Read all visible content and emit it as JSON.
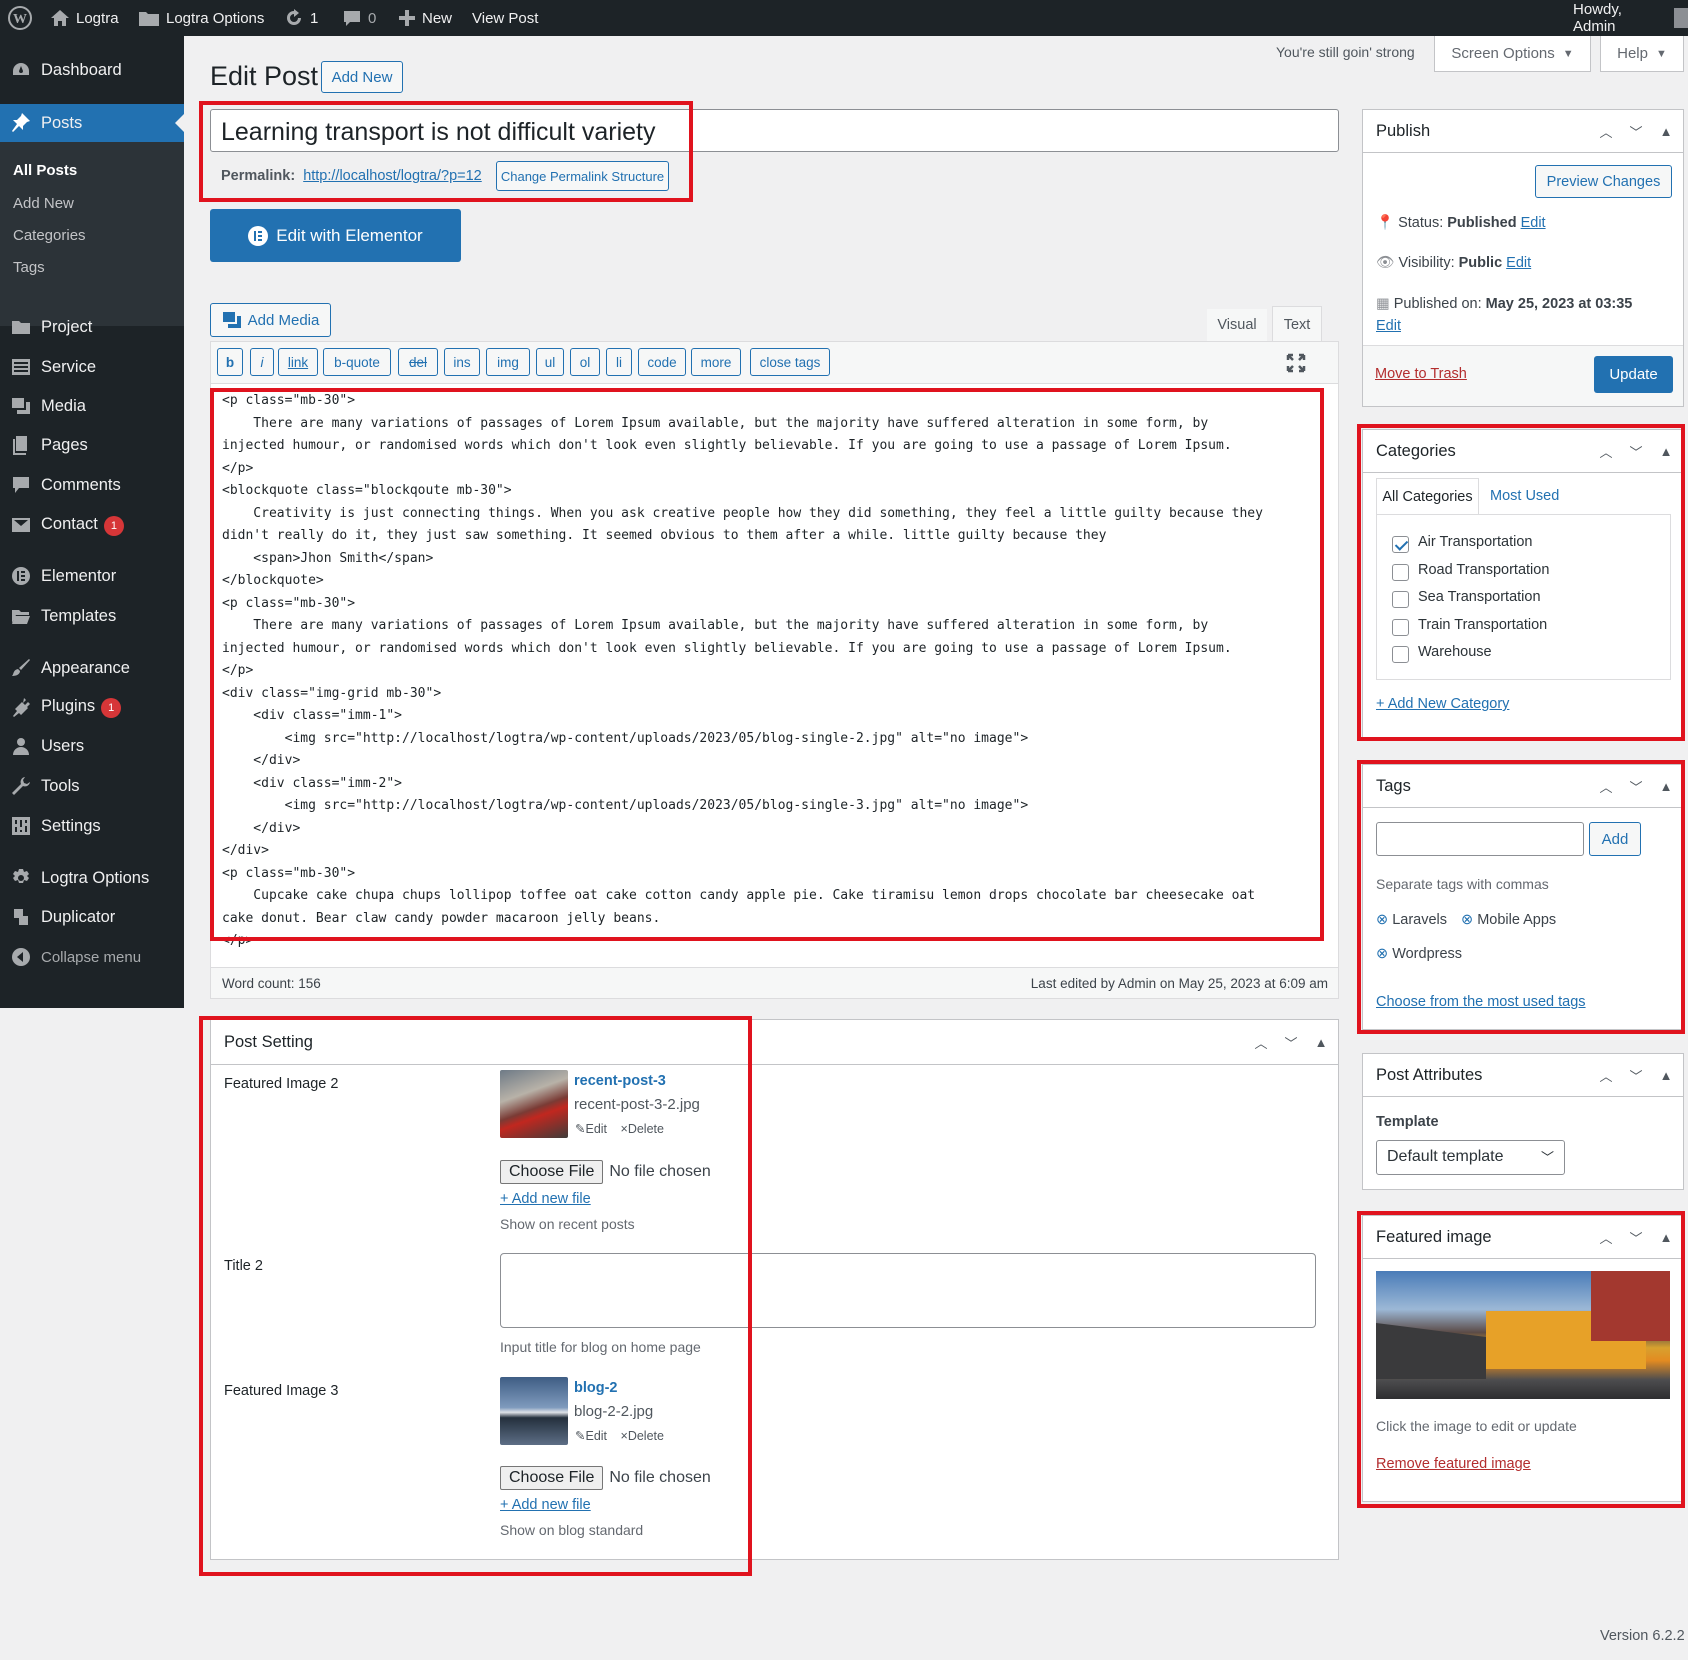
{
  "adminbar": {
    "site": "Logtra",
    "options": "Logtra Options",
    "updates": "1",
    "comments": "0",
    "new": "New",
    "view_post": "View Post",
    "howdy": "Howdy, Admin"
  },
  "sidebar": {
    "dashboard": "Dashboard",
    "posts": "Posts",
    "posts_sub": [
      "All Posts",
      "Add New",
      "Categories",
      "Tags"
    ],
    "project": "Project",
    "service": "Service",
    "media": "Media",
    "pages": "Pages",
    "comments": "Comments",
    "contact": "Contact",
    "contact_badge": "1",
    "elementor": "Elementor",
    "templates": "Templates",
    "appearance": "Appearance",
    "plugins": "Plugins",
    "plugins_badge": "1",
    "users": "Users",
    "tools": "Tools",
    "settings": "Settings",
    "logtra_options": "Logtra Options",
    "duplicator": "Duplicator",
    "collapse": "Collapse menu"
  },
  "header": {
    "quote": "You're still goin' strong",
    "screen_options": "Screen Options",
    "help": "Help",
    "page_title": "Edit Post",
    "add_new": "Add New"
  },
  "post": {
    "title": "Learning transport is not difficult variety",
    "permalink_label": "Permalink:",
    "permalink_url": "http://localhost/logtra/?p=12",
    "change_permalink": "Change Permalink Structure",
    "elementor_btn": "Edit with Elementor"
  },
  "editor": {
    "add_media": "Add Media",
    "tab_visual": "Visual",
    "tab_text": "Text",
    "quicktags": [
      "b",
      "i",
      "link",
      "b-quote",
      "del",
      "ins",
      "img",
      "ul",
      "ol",
      "li",
      "code",
      "more",
      "close tags"
    ],
    "content": "<p class=\"mb-30\">\n    There are many variations of passages of Lorem Ipsum available, but the majority have suffered alteration in some form, by\ninjected humour, or randomised words which don't look even slightly believable. If you are going to use a passage of Lorem Ipsum.\n</p>\n<blockquote class=\"blockqoute mb-30\">\n    Creativity is just connecting things. When you ask creative people how they did something, they feel a little guilty because they\ndidn't really do it, they just saw something. It seemed obvious to them after a while. little guilty because they\n    <span>Jhon Smith</span>\n</blockquote>\n<p class=\"mb-30\">\n    There are many variations of passages of Lorem Ipsum available, but the majority have suffered alteration in some form, by\ninjected humour, or randomised words which don't look even slightly believable. If you are going to use a passage of Lorem Ipsum.\n</p>\n<div class=\"img-grid mb-30\">\n    <div class=\"imm-1\">\n        <img src=\"http://localhost/logtra/wp-content/uploads/2023/05/blog-single-2.jpg\" alt=\"no image\">\n    </div>\n    <div class=\"imm-2\">\n        <img src=\"http://localhost/logtra/wp-content/uploads/2023/05/blog-single-3.jpg\" alt=\"no image\">\n    </div>\n</div>\n<p class=\"mb-30\">\n    Cupcake cake chupa chups lollipop toffee oat cake cotton candy apple pie. Cake tiramisu lemon drops chocolate bar cheesecake oat\ncake donut. Bear claw candy powder macaroon jelly beans.\n</p>",
    "word_count": "Word count: 156",
    "last_edited": "Last edited by Admin on May 25, 2023 at 6:09 am"
  },
  "post_setting": {
    "title": "Post Setting",
    "featured2_label": "Featured Image 2",
    "featured2_name": "recent-post-3",
    "featured2_file": "recent-post-3-2.jpg",
    "edit": "Edit",
    "delete": "Delete",
    "choose_file": "Choose File",
    "no_file": "No file chosen",
    "add_new_file": "+ Add new file",
    "featured2_desc": "Show on recent posts",
    "title2_label": "Title 2",
    "title2_desc": "Input title for blog on home page",
    "featured3_label": "Featured Image 3",
    "featured3_name": "blog-2",
    "featured3_file": "blog-2-2.jpg",
    "featured3_desc": "Show on blog standard"
  },
  "publish": {
    "title": "Publish",
    "preview": "Preview Changes",
    "status_label": "Status:",
    "status_value": "Published",
    "visibility_label": "Visibility:",
    "visibility_value": "Public",
    "published_label": "Published on:",
    "published_value": "May 25, 2023 at 03:35",
    "edit": "Edit",
    "trash": "Move to Trash",
    "update": "Update"
  },
  "categories": {
    "title": "Categories",
    "tab_all": "All Categories",
    "tab_used": "Most Used",
    "items": [
      {
        "label": "Air Transportation",
        "checked": true
      },
      {
        "label": "Road Transportation",
        "checked": false
      },
      {
        "label": "Sea Transportation",
        "checked": false
      },
      {
        "label": "Train Transportation",
        "checked": false
      },
      {
        "label": "Warehouse",
        "checked": false
      }
    ],
    "add_new": "+ Add New Category"
  },
  "tags": {
    "title": "Tags",
    "add": "Add",
    "hint": "Separate tags with commas",
    "items": [
      "Laravels",
      "Mobile Apps",
      "Wordpress"
    ],
    "choose": "Choose from the most used tags"
  },
  "attributes": {
    "title": "Post Attributes",
    "template_label": "Template",
    "template_value": "Default template"
  },
  "featured": {
    "title": "Featured image",
    "hint": "Click the image to edit or update",
    "remove": "Remove featured image"
  },
  "footer": {
    "version": "Version 6.2.2"
  },
  "colors": {
    "accent": "#2271b1",
    "admin_dark": "#1d2327",
    "highlight_red": "#e0131e",
    "badge": "#d63638"
  }
}
